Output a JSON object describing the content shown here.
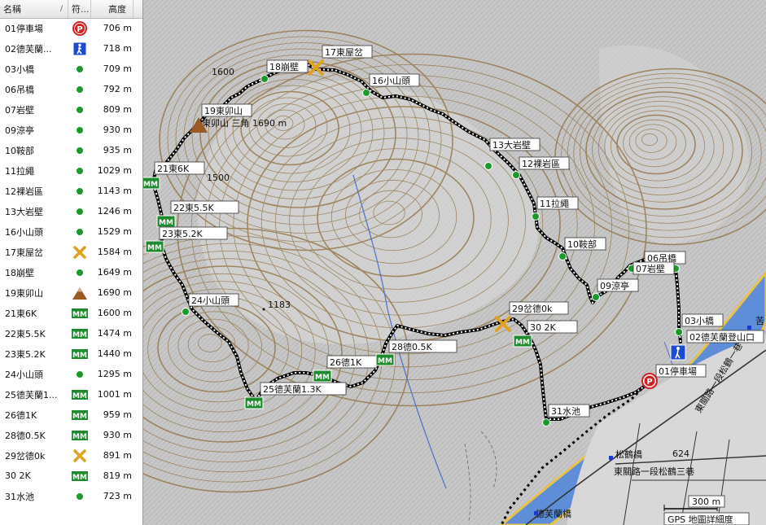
{
  "table": {
    "header": {
      "name": "名稱",
      "sym": "符...",
      "alt": "高度"
    },
    "rows": [
      {
        "name": "01停車場",
        "sym": "parking",
        "alt": "706 m"
      },
      {
        "name": "02德芙蘭...",
        "sym": "trailhead",
        "alt": "718 m"
      },
      {
        "name": "03小橋",
        "sym": "dot",
        "alt": "709 m"
      },
      {
        "name": "06吊橋",
        "sym": "dot",
        "alt": "792 m"
      },
      {
        "name": "07岩壁",
        "sym": "dot",
        "alt": "809 m"
      },
      {
        "name": "09涼亭",
        "sym": "dot",
        "alt": "930 m"
      },
      {
        "name": "10鞍部",
        "sym": "dot",
        "alt": "935 m"
      },
      {
        "name": "11拉繩",
        "sym": "dot",
        "alt": "1029 m"
      },
      {
        "name": "12裸岩區",
        "sym": "dot",
        "alt": "1143 m"
      },
      {
        "name": "13大岩壁",
        "sym": "dot",
        "alt": "1246 m"
      },
      {
        "name": "16小山頭",
        "sym": "dot",
        "alt": "1529 m"
      },
      {
        "name": "17東屋岔",
        "sym": "cross",
        "alt": "1584 m"
      },
      {
        "name": "18崩壁",
        "sym": "dot",
        "alt": "1649 m"
      },
      {
        "name": "19東卯山",
        "sym": "summit",
        "alt": "1690 m"
      },
      {
        "name": "21東6K",
        "sym": "mileage",
        "alt": "1600 m"
      },
      {
        "name": "22東5.5K",
        "sym": "mileage",
        "alt": "1474 m"
      },
      {
        "name": "23東5.2K",
        "sym": "mileage",
        "alt": "1440 m"
      },
      {
        "name": "24小山頭",
        "sym": "dot",
        "alt": "1295 m"
      },
      {
        "name": "25德芙蘭1...",
        "sym": "mileage",
        "alt": "1001 m"
      },
      {
        "name": "26德1K",
        "sym": "mileage",
        "alt": "959 m"
      },
      {
        "name": "28德0.5K",
        "sym": "mileage",
        "alt": "930 m"
      },
      {
        "name": "29岔德0k",
        "sym": "cross",
        "alt": "891 m"
      },
      {
        "name": "30 2K",
        "sym": "mileage",
        "alt": "819 m"
      },
      {
        "name": "31水池",
        "sym": "dot",
        "alt": "723 m"
      }
    ]
  },
  "symbols": {
    "parking": {
      "text": "P",
      "color": "#d42020"
    },
    "trailhead": {
      "color": "#1a4bd0"
    },
    "dot": {
      "color": "#1a9a2a"
    },
    "cross": {
      "color": "#e0a020"
    },
    "summit": {
      "color": "#9a5a22"
    },
    "mileage": {
      "text": "MM",
      "color": "#1e8c2e"
    }
  },
  "map": {
    "labels": {
      "l01": "01停車場",
      "l02": "02德芙蘭登山口",
      "l03": "03小橋",
      "l06": "06吊橋",
      "l07": "07岩壁",
      "l09": "09涼亭",
      "l10": "10鞍部",
      "l11": "11拉繩",
      "l12": "12裸岩區",
      "l13": "13大岩壁",
      "l16": "16小山頭",
      "l17": "17東屋岔",
      "l18": "18崩壁",
      "l19": "19東卯山",
      "l21": "21東6K",
      "l22": "22東5.5K",
      "l23": "23東5.2K",
      "l24": "24小山頭",
      "l25": "25德芙蘭1.3K",
      "l26": "26德1K",
      "l28": "28德0.5K",
      "l29": "29岔德0k",
      "l30": "30 2K",
      "l31": "31水池"
    },
    "summit_note": "東卯山 三角 1690 m",
    "contour_1600": "1600",
    "contour_1500": "1500",
    "spot_height": "1183",
    "spot_624": "624",
    "road_label": "東關路一段松鶴三巷",
    "road_label2": "東關路一段松鶴一巷",
    "bridge1": "松鶴橋",
    "bridge2": "德芙蘭橋",
    "side_label": "苦",
    "scale": "300 m",
    "footer": "GPS 地圖詳細度"
  }
}
